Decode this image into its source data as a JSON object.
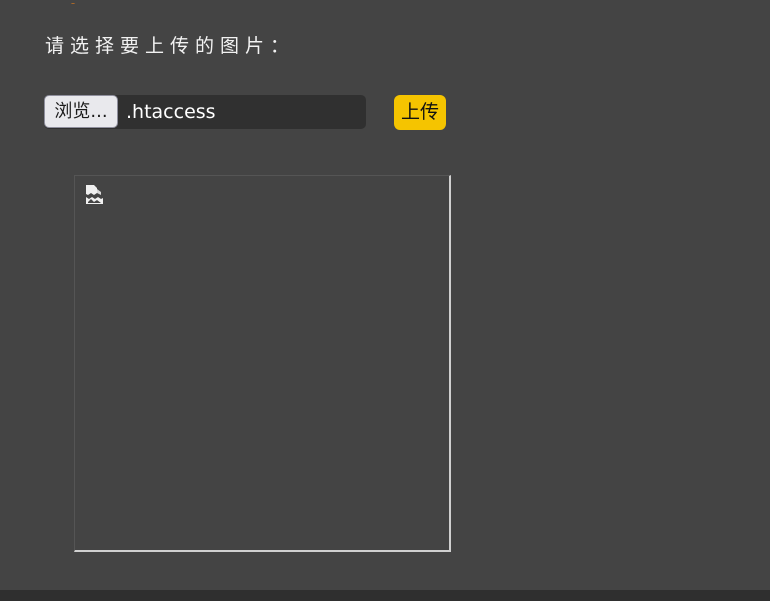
{
  "upload_form": {
    "prompt": "请选择要上传的图片：",
    "browse_label": "浏览...",
    "selected_file": ".htaccess",
    "upload_label": "上传"
  },
  "preview": {
    "icon": "broken-image-icon"
  },
  "colors": {
    "background": "#444444",
    "upload_button": "#f5c400",
    "file_field": "#303030",
    "browse_button": "#e9e9ed",
    "footer_bar": "#2f2f2f"
  }
}
